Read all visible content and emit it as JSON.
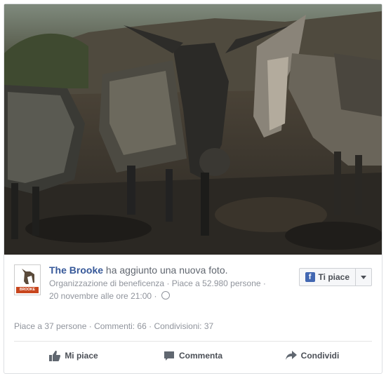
{
  "post": {
    "photo_alt": "Three donkeys carrying loaded sacks on rocky ground",
    "page_name": "The Brooke",
    "action_text": " ha aggiunto una nuova foto.",
    "category": "Organizzazione di beneficenza",
    "page_likes": "Piace a 52.980 persone",
    "separator": " · ",
    "timestamp": "20 novembre alle ore 21:00",
    "like_page_label": "Ti piace",
    "avatar_label": "BROOKE"
  },
  "stats": {
    "likes": "Piace a 37 persone",
    "comments": "Commenti: 66",
    "shares": "Condivisioni: 37",
    "separator": " · "
  },
  "actions": {
    "like": "Mi piace",
    "comment": "Commenta",
    "share": "Condividi"
  },
  "colors": {
    "link": "#365899",
    "meta": "#90949c",
    "facebook_blue": "#4267b2"
  },
  "icons": {
    "like": "thumbs-up-icon",
    "comment": "comment-bubble-icon",
    "share": "share-arrow-icon",
    "privacy": "globe-icon",
    "dropdown": "caret-down-icon"
  }
}
